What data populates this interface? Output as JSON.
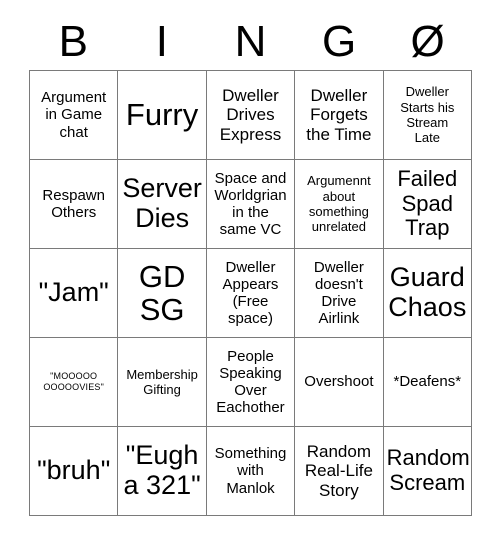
{
  "card": {
    "header_letters": [
      "B",
      "I",
      "N",
      "G",
      "Ø"
    ],
    "free_space_index": 12,
    "colors": {
      "background": "#ffffff",
      "text": "#000000",
      "grid_line": "#7a7a7a"
    },
    "cells": [
      {
        "text": "Argument\nin Game\nchat",
        "size": "fs-sm"
      },
      {
        "text": "Furry",
        "size": "fs-xxl"
      },
      {
        "text": "Dweller\nDrives\nExpress",
        "size": "fs-md"
      },
      {
        "text": "Dweller\nForgets\nthe Time",
        "size": "fs-md"
      },
      {
        "text": "Dweller\nStarts his\nStream\nLate",
        "size": "fs-xs"
      },
      {
        "text": "Respawn\nOthers",
        "size": "fs-sm"
      },
      {
        "text": "Server\nDies",
        "size": "fs-xl"
      },
      {
        "text": "Space and\nWorldgrian\nin the\nsame VC",
        "size": "fs-sm"
      },
      {
        "text": "Argumennt\nabout\nsomething\nunrelated",
        "size": "fs-xs"
      },
      {
        "text": "Failed\nSpad\nTrap",
        "size": "fs-lg"
      },
      {
        "text": "\"Jam\"",
        "size": "fs-xl"
      },
      {
        "text": "GD\nSG",
        "size": "fs-xxl"
      },
      {
        "text": "Dweller\nAppears\n(Free\nspace)",
        "size": "fs-sm"
      },
      {
        "text": "Dweller\ndoesn't\nDrive\nAirlink",
        "size": "fs-sm"
      },
      {
        "text": "Guard\nChaos",
        "size": "fs-xl"
      },
      {
        "text": "\"MOOOOO\nOOOOOVIES\"",
        "size": "fs-xxs"
      },
      {
        "text": "Membership\nGifting",
        "size": "fs-xs"
      },
      {
        "text": "People\nSpeaking\nOver\nEachother",
        "size": "fs-sm"
      },
      {
        "text": "Overshoot",
        "size": "fs-sm"
      },
      {
        "text": "*Deafens*",
        "size": "fs-sm"
      },
      {
        "text": "\"bruh\"",
        "size": "fs-xl"
      },
      {
        "text": "\"Eugh\na 321\"",
        "size": "fs-xl"
      },
      {
        "text": "Something\nwith\nManlok",
        "size": "fs-sm"
      },
      {
        "text": "Random\nReal-Life\nStory",
        "size": "fs-md"
      },
      {
        "text": "Random\nScream",
        "size": "fs-lg"
      }
    ]
  }
}
